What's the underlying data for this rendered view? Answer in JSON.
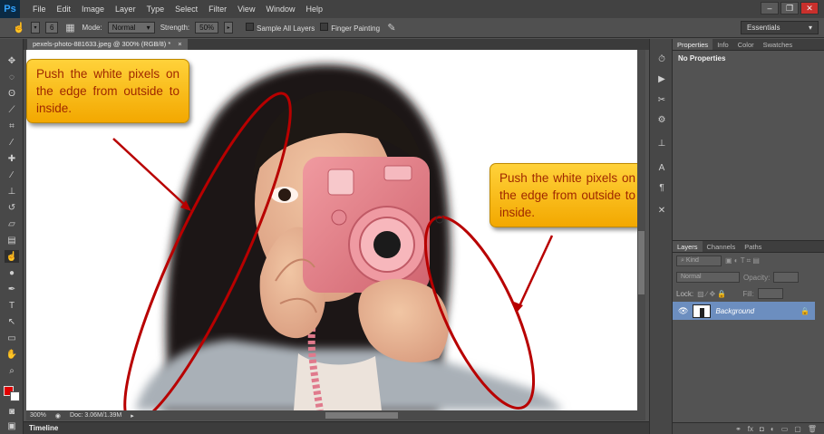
{
  "app": {
    "logo": "Ps"
  },
  "menu": [
    "File",
    "Edit",
    "Image",
    "Layer",
    "Type",
    "Select",
    "Filter",
    "View",
    "Window",
    "Help"
  ],
  "window_controls": {
    "minimize": "–",
    "restore": "❐",
    "close": "✕"
  },
  "options": {
    "brush_size": "6",
    "mode_label": "Mode:",
    "mode_value": "Normal",
    "strength_label": "Strength:",
    "strength_value": "50%",
    "sample_all_layers": "Sample All Layers",
    "finger_painting": "Finger Painting",
    "workspace": "Essentials"
  },
  "document": {
    "tab_title": "pexels-photo-881633.jpeg @ 300% (RGB/8) *",
    "tab_close": "×"
  },
  "status": {
    "zoom": "300%",
    "doc_size": "Doc: 3.06M/1.39M"
  },
  "timeline_label": "Timeline",
  "callouts": {
    "left": "Push the white pixels on the edge from outside to inside.",
    "right": "Push the white pixels on the edge from outside to inside."
  },
  "panels": {
    "top_tabs": [
      "Properties",
      "Info",
      "Color",
      "Swatches"
    ],
    "no_properties": "No Properties",
    "layer_tabs": [
      "Layers",
      "Channels",
      "Paths"
    ],
    "kind_label": "Kind",
    "blend_mode": "Normal",
    "opacity_label": "Opacity:",
    "lock_label": "Lock:",
    "fill_label": "Fill:",
    "layer_name": "Background"
  },
  "colors": {
    "foreground": "#e00000",
    "background": "#ffffff",
    "callout_text": "#a02800",
    "ellipse": "#b80000"
  }
}
